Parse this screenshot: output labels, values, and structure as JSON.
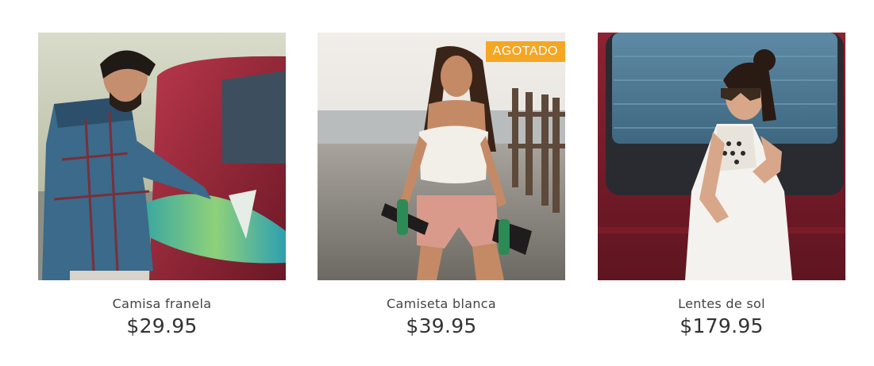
{
  "products": [
    {
      "name": "Camisa franela",
      "price": "$29.95",
      "image": "man-plaid-shirt-surfboard-van"
    },
    {
      "name": "Camiseta blanca",
      "price": "$39.95",
      "badge": "AGOTADO",
      "image": "woman-white-top-beach-skateboard"
    },
    {
      "name": "Lentes de sol",
      "price": "$179.95",
      "image": "woman-sunglasses-white-dress-van"
    }
  ],
  "colors": {
    "badge": "#f5a623",
    "text": "#333333"
  }
}
